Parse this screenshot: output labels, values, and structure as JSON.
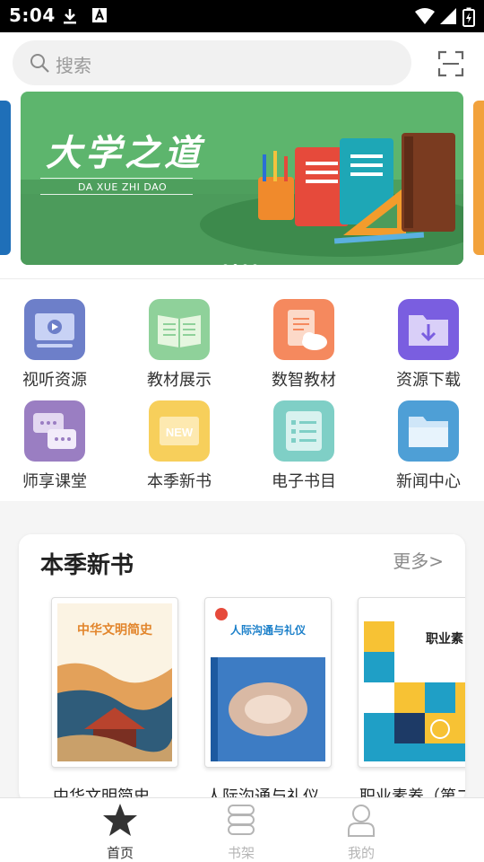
{
  "status_bar": {
    "time": "5:04"
  },
  "search": {
    "placeholder": "搜索"
  },
  "banner": {
    "title": "大学之道",
    "subtitle": "DA XUE ZHI DAO",
    "page_count": 4,
    "active_page": 2
  },
  "grid": {
    "items": [
      {
        "label": "视听资源",
        "icon": "video-resource-icon",
        "color": "#6d7fc9"
      },
      {
        "label": "教材展示",
        "icon": "open-book-icon",
        "color": "#8fd19a"
      },
      {
        "label": "数智教材",
        "icon": "cloud-document-icon",
        "color": "#f5895e"
      },
      {
        "label": "资源下载",
        "icon": "folder-download-icon",
        "color": "#7a5ee0"
      },
      {
        "label": "师享课堂",
        "icon": "chat-bubbles-icon",
        "color": "#9a7ec2"
      },
      {
        "label": "本季新书",
        "icon": "new-book-icon",
        "color": "#f7cf5b"
      },
      {
        "label": "电子书目",
        "icon": "list-icon",
        "color": "#7fcfc6"
      },
      {
        "label": "新闻中心",
        "icon": "folder-icon",
        "color": "#4e9fd6"
      }
    ]
  },
  "new_books": {
    "title": "本季新书",
    "more": "更多>",
    "books": [
      {
        "title": "中华文明简史",
        "cover_title": "中华文明简史"
      },
      {
        "title": "人际沟通与礼仪",
        "cover_title": "人际沟通与礼仪"
      },
      {
        "title": "职业素养（第二",
        "cover_title": "职业素"
      }
    ]
  },
  "bottom_nav": {
    "items": [
      {
        "label": "首页",
        "icon": "star-icon",
        "active": true
      },
      {
        "label": "书架",
        "icon": "bookshelf-icon",
        "active": false
      },
      {
        "label": "我的",
        "icon": "user-icon",
        "active": false
      }
    ],
    "active_color": "#333333",
    "inactive_color": "#b5b5b5"
  }
}
